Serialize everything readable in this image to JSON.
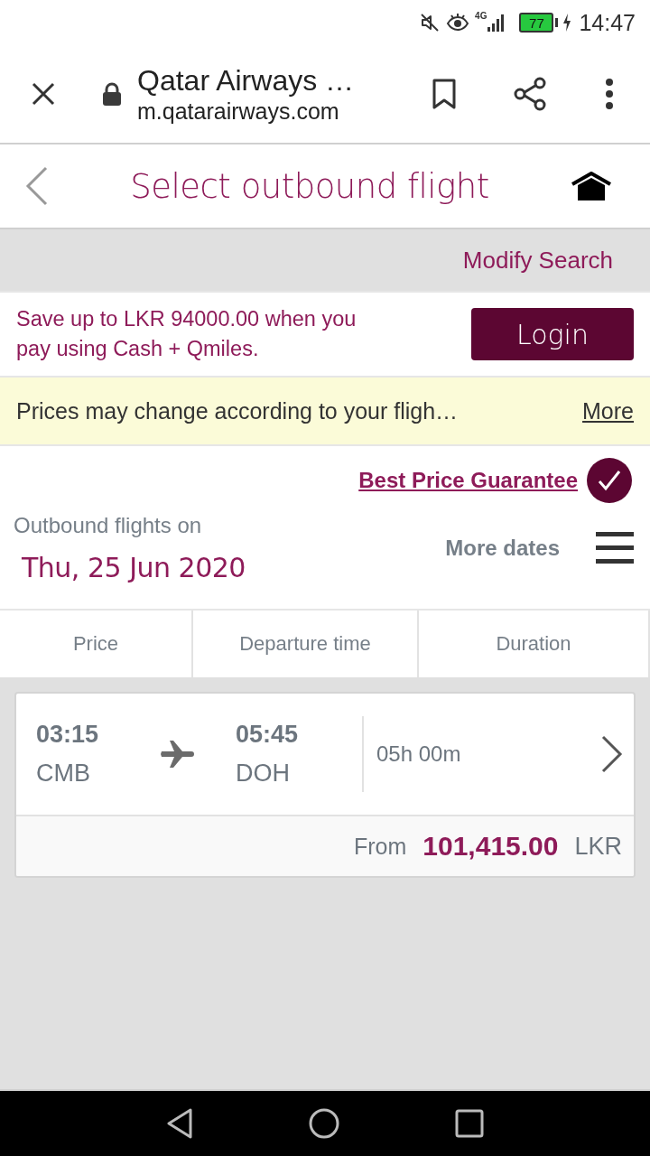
{
  "status_bar": {
    "network": "4G",
    "battery": "77",
    "time": "14:47"
  },
  "browser_bar": {
    "title": "Qatar Airways …",
    "url": "m.qatarairways.com"
  },
  "page_header": {
    "title": "Select outbound flight"
  },
  "modify_search": "Modify Search",
  "promo": {
    "text": "Save up to LKR 94000.00 when you pay using Cash + Qmiles.",
    "button": "Login"
  },
  "notice": {
    "text": "Prices may change according to your fligh…",
    "link": "More"
  },
  "best_price": {
    "label": "Best Price Guarantee"
  },
  "date_section": {
    "heading": "Outbound flights on",
    "date": "Thu, 25 Jun 2020",
    "more_dates": "More dates"
  },
  "sort_tabs": [
    {
      "label": "Price",
      "selected": false
    },
    {
      "label": "Departure time",
      "selected": false
    },
    {
      "label": "Duration",
      "selected": false
    }
  ],
  "flights": [
    {
      "departure_time": "03:15",
      "origin": "CMB",
      "arrival_time": "05:45",
      "destination": "DOH",
      "duration": "05h 00m",
      "from_label": "From",
      "price": "101,415.00",
      "currency": "LKR"
    }
  ]
}
